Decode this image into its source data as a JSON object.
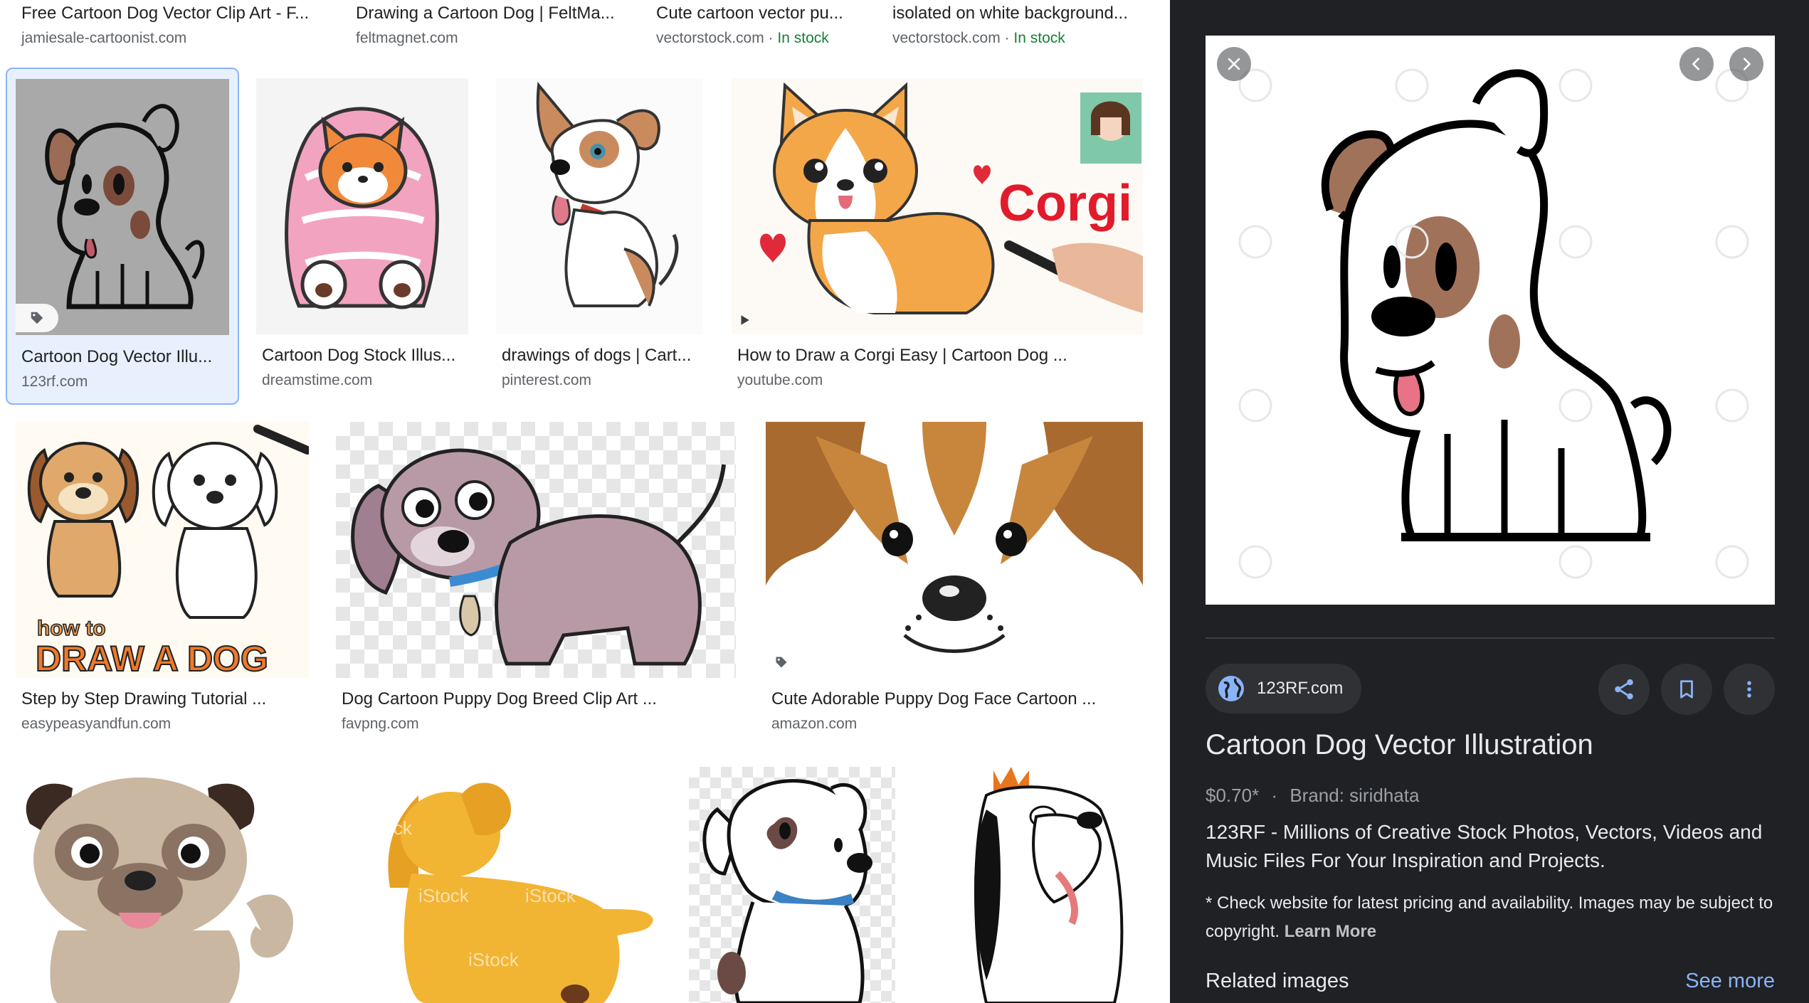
{
  "top_row": [
    {
      "title": "Free Cartoon Dog Vector Clip Art - F...",
      "source": "jamiesale-cartoonist.com",
      "stock": ""
    },
    {
      "title": "Drawing a Cartoon Dog | FeltMa...",
      "source": "feltmagnet.com",
      "stock": ""
    },
    {
      "title": "Cute cartoon vector pu...",
      "source": "vectorstock.com",
      "stock": "In stock"
    },
    {
      "title": "isolated on white background...",
      "source": "vectorstock.com",
      "stock": "In stock"
    }
  ],
  "row1": [
    {
      "title": "Cartoon Dog Vector Illu...",
      "source": "123rf.com"
    },
    {
      "title": "Cartoon Dog Stock Illus...",
      "source": "dreamstime.com"
    },
    {
      "title": "drawings of dogs | Cart...",
      "source": "pinterest.com"
    },
    {
      "title": "How to Draw a Corgi Easy | Cartoon Dog ...",
      "source": "youtube.com",
      "overlay_text": "Corgi"
    }
  ],
  "row2": [
    {
      "title": "Step by Step Drawing Tutorial ...",
      "source": "easypeasyandfun.com",
      "overlay_line1": "how to",
      "overlay_line2": "DRAW A DOG"
    },
    {
      "title": "Dog Cartoon Puppy Dog Breed Clip Art ...",
      "source": "favpng.com"
    },
    {
      "title": "Cute Adorable Puppy Dog Face Cartoon ...",
      "source": "amazon.com"
    }
  ],
  "row3_watermark": "iStock",
  "panel": {
    "site_name": "123RF.com",
    "title": "Cartoon Dog Vector Illustration",
    "price": "$0.70*",
    "separator": "·",
    "brand": "Brand: siridhata",
    "description": "123RF - Millions of Creative Stock Photos, Vectors, Videos and Music Files For Your Inspiration and Projects.",
    "note": "* Check website for latest pricing and availability. Images may be subject to copyright.",
    "learn_more": "Learn More",
    "related_label": "Related images",
    "see_more": "See more",
    "accent_color": "#8ab4f8",
    "background_color": "#202124"
  },
  "icons": [
    "close-icon",
    "chevron-left-icon",
    "chevron-right-icon",
    "globe-icon",
    "share-icon",
    "bookmark-icon",
    "more-vert-icon",
    "tag-icon",
    "play-icon"
  ]
}
